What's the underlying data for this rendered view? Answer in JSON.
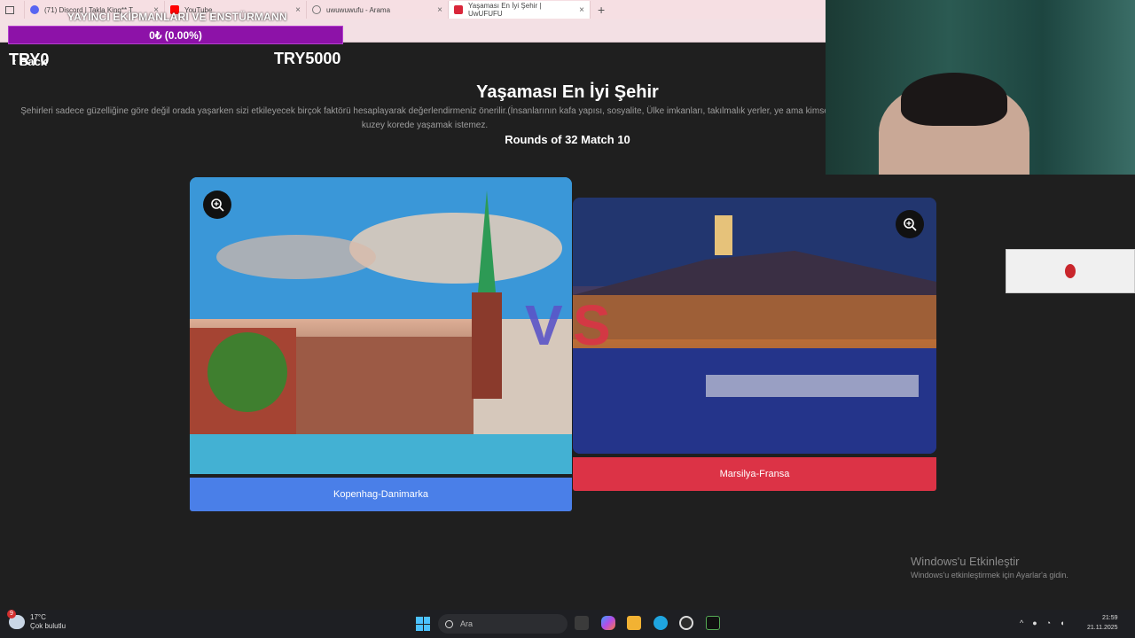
{
  "browser": {
    "tabs": [
      {
        "label": "(71) Discord | Takla King** T",
        "color": "#5865f2",
        "active": false
      },
      {
        "label": "YouTube",
        "color": "#ff0000",
        "active": false
      },
      {
        "label": "uwuwuwufu - Arama",
        "color": "#888888",
        "active": false
      },
      {
        "label": "Yaşaması En İyi Şehir | UwUFUFU",
        "color": "#d9263a",
        "active": true
      }
    ],
    "new_tab": "+"
  },
  "overlay": {
    "title": "YAYINCI EKİPMANLARI VE ENSTÜRMANN",
    "progress": "0₺ (0.00%)",
    "progress_fraction": 0.0
  },
  "page": {
    "balance_left": "TRY0",
    "back": "Back",
    "balance_goal": "TRY5000",
    "title": "Yaşaması En İyi Şehir",
    "description": "Şehirleri sadece güzelliğine göre değil orada yaşarken sizi etkileyecek birçok faktörü hesaplayarak değerlendirmeniz önerilir.(İnsanlarının kafa yapısı, sosyalite, Ülke imkanları, takılmalık yerler, ye ama kimse kuzey korede yaşamak istemez.",
    "rounds": "Rounds of 32 Match 10",
    "vs_v": "V",
    "vs_s": "S",
    "left_choice": {
      "label": "Kopenhag-Danimarka",
      "color": "#4a7fe8"
    },
    "right_choice": {
      "label": "Marsilya-Fransa",
      "color": "#dc3346"
    }
  },
  "windows_activation": {
    "heading": "Windows'u Etkinleştir",
    "subtitle": "Windows'u etkinleştirmek için Ayarlar'a gidin."
  },
  "taskbar": {
    "weather_temp": "17°C",
    "weather_desc": "Çok bulutlu",
    "weather_badge": "9",
    "search_placeholder": "Ara",
    "time": "21:59",
    "date": "21.11.2025"
  }
}
